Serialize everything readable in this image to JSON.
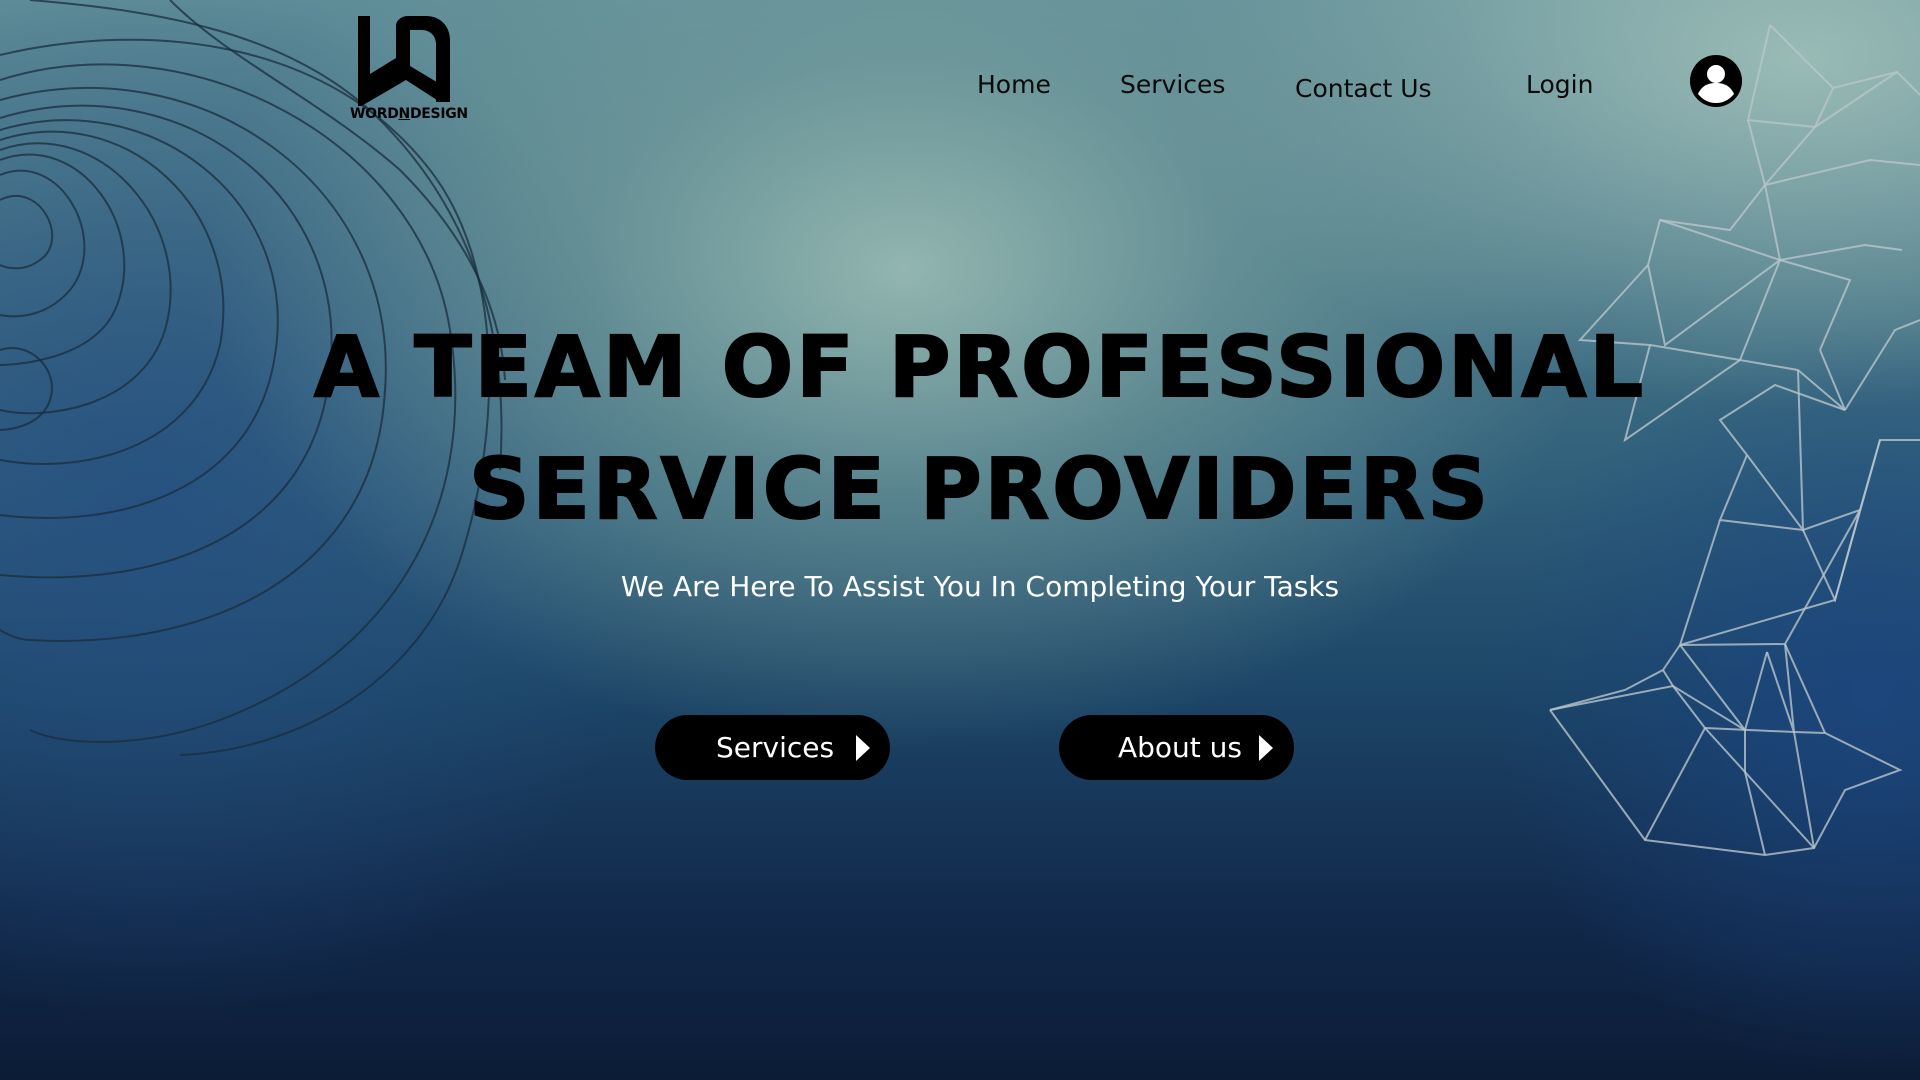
{
  "brand": {
    "name": "WORDNDESIGN",
    "name_pre": "WORD",
    "name_n": "N",
    "name_post": "DESIGN",
    "icon": "wd-monogram-icon"
  },
  "nav": {
    "items": [
      {
        "label": "Home"
      },
      {
        "label": "Services"
      },
      {
        "label": "Contact Us"
      },
      {
        "label": "Login"
      }
    ],
    "user_icon": "user-account-icon"
  },
  "hero": {
    "headline_line1": "A TEAM OF PROFESSIONAL",
    "headline_line2": "SERVICE PROVIDERS",
    "subtitle": "We Are Here To Assist You In Completing Your Tasks"
  },
  "buttons": [
    {
      "label": "Services",
      "icon": "caret-right-icon"
    },
    {
      "label": "About us",
      "icon": "caret-right-icon"
    }
  ],
  "colors": {
    "button_bg": "#000000",
    "button_text": "#ffffff",
    "headline": "#000000",
    "subtitle": "#ffffff",
    "background_top": "#5e8c97",
    "background_bottom": "#0c1c36"
  },
  "decorations": {
    "left": "topographic-contour-lines",
    "right": "geometric-wireframe-mesh"
  }
}
